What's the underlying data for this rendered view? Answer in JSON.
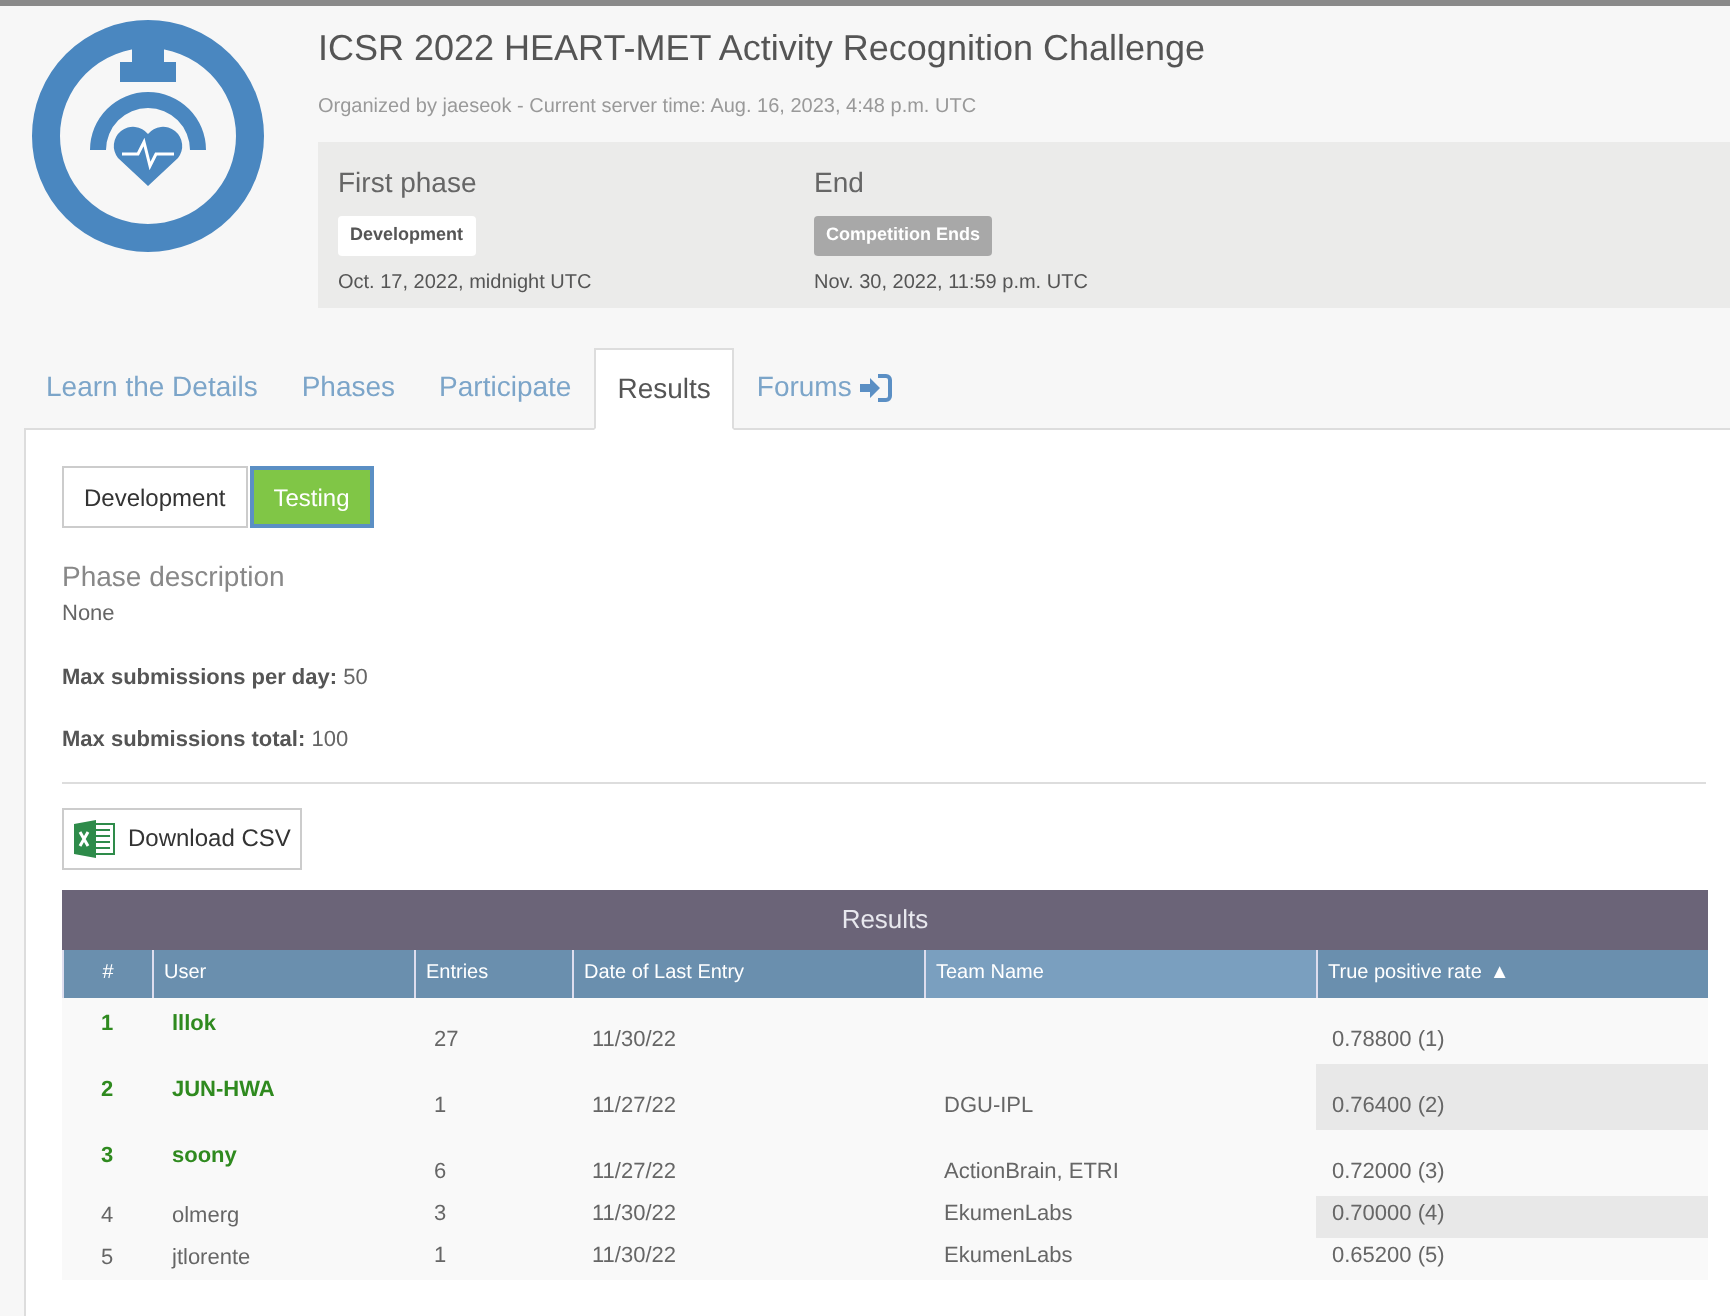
{
  "competition": {
    "title": "ICSR 2022 HEART-MET Activity Recognition Challenge",
    "organizer_line": "Organized by jaeseok - Current server time: Aug. 16, 2023, 4:48 p.m. UTC"
  },
  "phases": [
    {
      "heading": "First phase",
      "badge": "Development",
      "badge_active": true,
      "date": "Oct. 17, 2022, midnight UTC"
    },
    {
      "heading": "End",
      "badge": "Competition Ends",
      "badge_active": false,
      "date": "Nov. 30, 2022, 11:59 p.m. UTC"
    }
  ],
  "tabs": [
    {
      "label": "Learn the Details",
      "selected": false,
      "kind": "plain"
    },
    {
      "label": "Phases",
      "selected": false,
      "kind": "plain"
    },
    {
      "label": "Participate",
      "selected": false,
      "kind": "plain"
    },
    {
      "label": "Results",
      "selected": true,
      "kind": "plain"
    },
    {
      "label": "Forums",
      "selected": false,
      "kind": "external"
    }
  ],
  "phase_buttons": [
    {
      "label": "Development",
      "selected": false
    },
    {
      "label": "Testing",
      "selected": true
    }
  ],
  "phase_description": {
    "heading": "Phase description",
    "text": "None"
  },
  "limits": [
    {
      "label": "Max submissions per day:",
      "value": "50"
    },
    {
      "label": "Max submissions total:",
      "value": "100"
    }
  ],
  "download_button": "Download CSV",
  "table": {
    "title": "Results",
    "columns": [
      {
        "label": "#",
        "highlighted": false
      },
      {
        "label": "User",
        "highlighted": false
      },
      {
        "label": "Entries",
        "highlighted": false
      },
      {
        "label": "Date of Last Entry",
        "highlighted": false
      },
      {
        "label": "Team Name",
        "highlighted": true
      },
      {
        "label": "True positive rate",
        "highlighted": false,
        "sort_icon": "▲"
      }
    ],
    "rows": [
      {
        "rank": "1",
        "user": "lllok",
        "top": true,
        "entries": "27",
        "date": "11/30/22",
        "rate": "0.78800 (1)"
      },
      {
        "rank": "2",
        "user": "JUN-HWA",
        "top": true,
        "entries": "1",
        "date": "11/27/22",
        "team": "DGU-IPL",
        "rate": "0.76400 (2)"
      },
      {
        "rank": "3",
        "user": "soony",
        "top": true,
        "entries": "6",
        "date": "11/27/22",
        "team": "ActionBrain, ETRI",
        "rate": "0.72000 (3)"
      },
      {
        "rank": "4",
        "user": "olmerg",
        "top": false,
        "entries": "3",
        "date": "11/30/22",
        "team": "EkumenLabs",
        "rate": "0.70000 (4)"
      },
      {
        "rank": "5",
        "user": "jtlorente",
        "top": false,
        "entries": "1",
        "date": "11/30/22",
        "team": "EkumenLabs",
        "rate": "0.65200 (5)"
      }
    ]
  }
}
